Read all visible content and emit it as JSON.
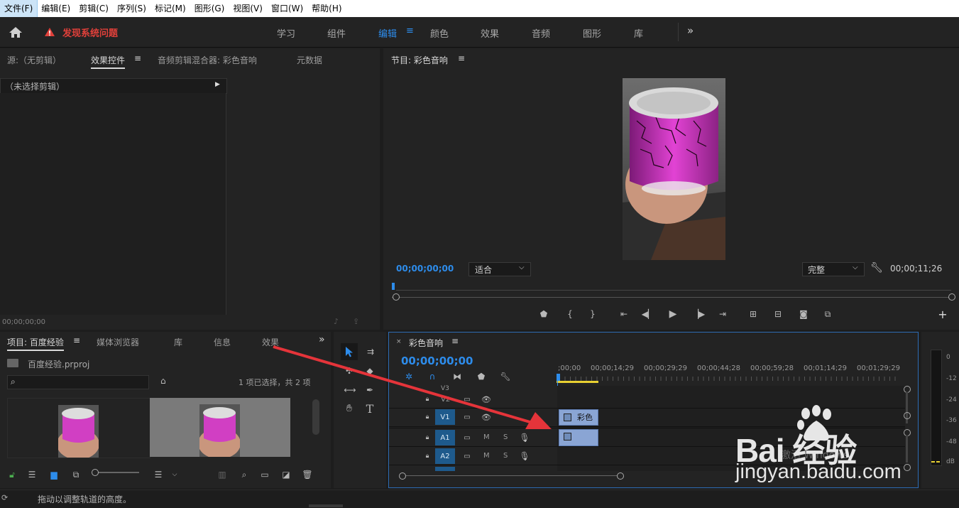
{
  "menubar": {
    "items": [
      "文件(F)",
      "编辑(E)",
      "剪辑(C)",
      "序列(S)",
      "标记(M)",
      "图形(G)",
      "视图(V)",
      "窗口(W)",
      "帮助(H)"
    ]
  },
  "workspace": {
    "warning": "发现系统问题",
    "tabs": [
      "学习",
      "组件",
      "编辑",
      "颜色",
      "效果",
      "音频",
      "图形",
      "库"
    ],
    "active_tab": "编辑"
  },
  "source_panel": {
    "tabs": [
      "源:（无剪辑）",
      "效果控件",
      "音频剪辑混合器: 彩色音响",
      "元数据"
    ],
    "no_clip": "（未选择剪辑）",
    "timecode": "00;00;00;00"
  },
  "program_panel": {
    "title": "节目: 彩色音响",
    "timecode": "00;00;00;00",
    "fit": "适合",
    "quality": "完整",
    "duration": "00;00;11;26"
  },
  "project_panel": {
    "tabs": [
      "项目: 百度经验",
      "媒体浏览器",
      "库",
      "信息",
      "效果"
    ],
    "file": "百度经验.prproj",
    "selection": "1 项已选择，共 2 项"
  },
  "timeline": {
    "title": "彩色音响",
    "timecode": "00;00;00;00",
    "ruler": [
      ";00;00",
      "00;00;14;29",
      "00;00;29;29",
      "00;00;44;28",
      "00;00;59;28",
      "00;01;14;29",
      "00;01;29;29"
    ],
    "tracks": [
      {
        "label": "V3"
      },
      {
        "label": "V2"
      },
      {
        "label": "V1"
      },
      {
        "label": "A1"
      },
      {
        "label": "A2"
      }
    ],
    "clip_label": "彩色",
    "mute": "M",
    "solo": "S"
  },
  "meter": {
    "scale": [
      "0",
      "-12",
      "-24",
      "-36",
      "-48",
      "dB"
    ]
  },
  "statusbar": {
    "text": "拖动以调整轨道的高度。"
  },
  "watermark": {
    "text": "Bai 经验",
    "url": "jingyan.baidu.com",
    "activation": "激活 Windows"
  },
  "colors": {
    "accent": "#2d8ceb",
    "warning": "#e0403a",
    "clip": "#7f9fd0",
    "arrow": "#e5343a"
  }
}
